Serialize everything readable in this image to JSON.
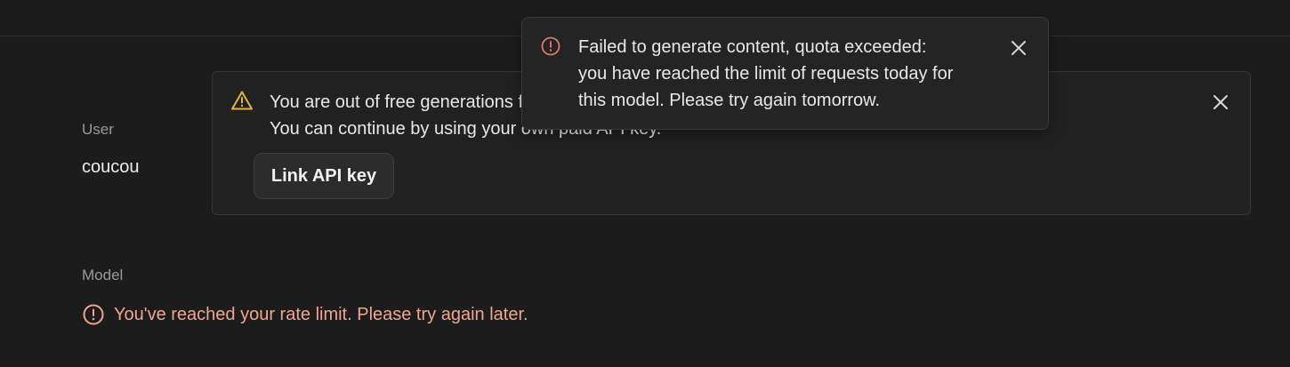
{
  "colors": {
    "background": "#1c1c1c",
    "warning": "#e2b53c",
    "error": "#e07a6a",
    "error_text": "#f3a48f"
  },
  "fields": {
    "user_label": "User",
    "user_value": "coucou",
    "model_label": "Model",
    "model_error": "You've reached your rate limit. Please try again later."
  },
  "banner": {
    "icon": "warning-triangle-icon",
    "line1": "You are out of free generations for today.",
    "line2": "You can continue by using your own paid API key.",
    "button_label": "Link API key",
    "close_icon": "close-icon"
  },
  "toast": {
    "icon": "error-circle-icon",
    "line1": "Failed to generate content, quota exceeded:",
    "line2": "you have reached the limit of requests today for",
    "line3": "this model. Please try again tomorrow.",
    "close_icon": "close-icon"
  }
}
